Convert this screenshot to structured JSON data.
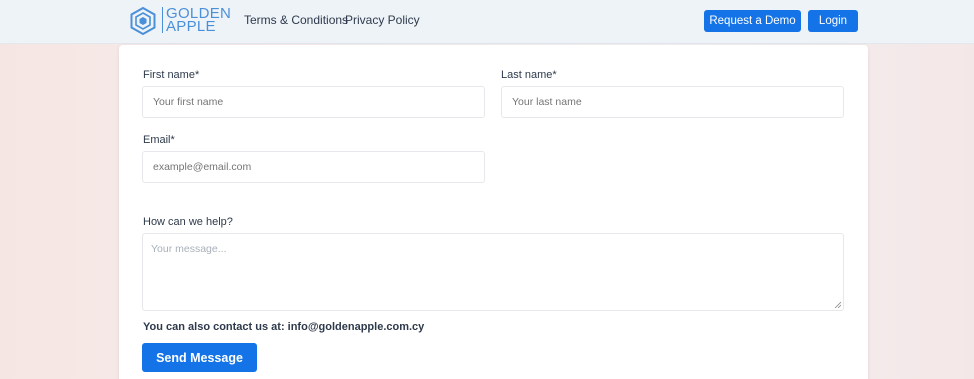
{
  "header": {
    "logo_line1": "GOLDEN",
    "logo_line2": "APPLE",
    "nav": {
      "terms": "Terms & Conditions",
      "privacy": "Privacy Policy"
    },
    "request_demo_label": "Request a Demo",
    "login_label": "Login"
  },
  "form": {
    "first_name": {
      "label": "First name*",
      "placeholder": "Your first name",
      "value": ""
    },
    "last_name": {
      "label": "Last name*",
      "placeholder": "Your last name",
      "value": ""
    },
    "email": {
      "label": "Email*",
      "placeholder": "example@email.com",
      "value": ""
    },
    "message": {
      "label": "How can we help?",
      "placeholder": "Your message...",
      "value": ""
    },
    "contact_note": "You can also contact us at: info@goldenapple.com.cy",
    "submit_label": "Send Message"
  },
  "colors": {
    "accent": "#1473e6",
    "logo": "#4a90d9",
    "navbar_bg": "#eef3f8"
  }
}
